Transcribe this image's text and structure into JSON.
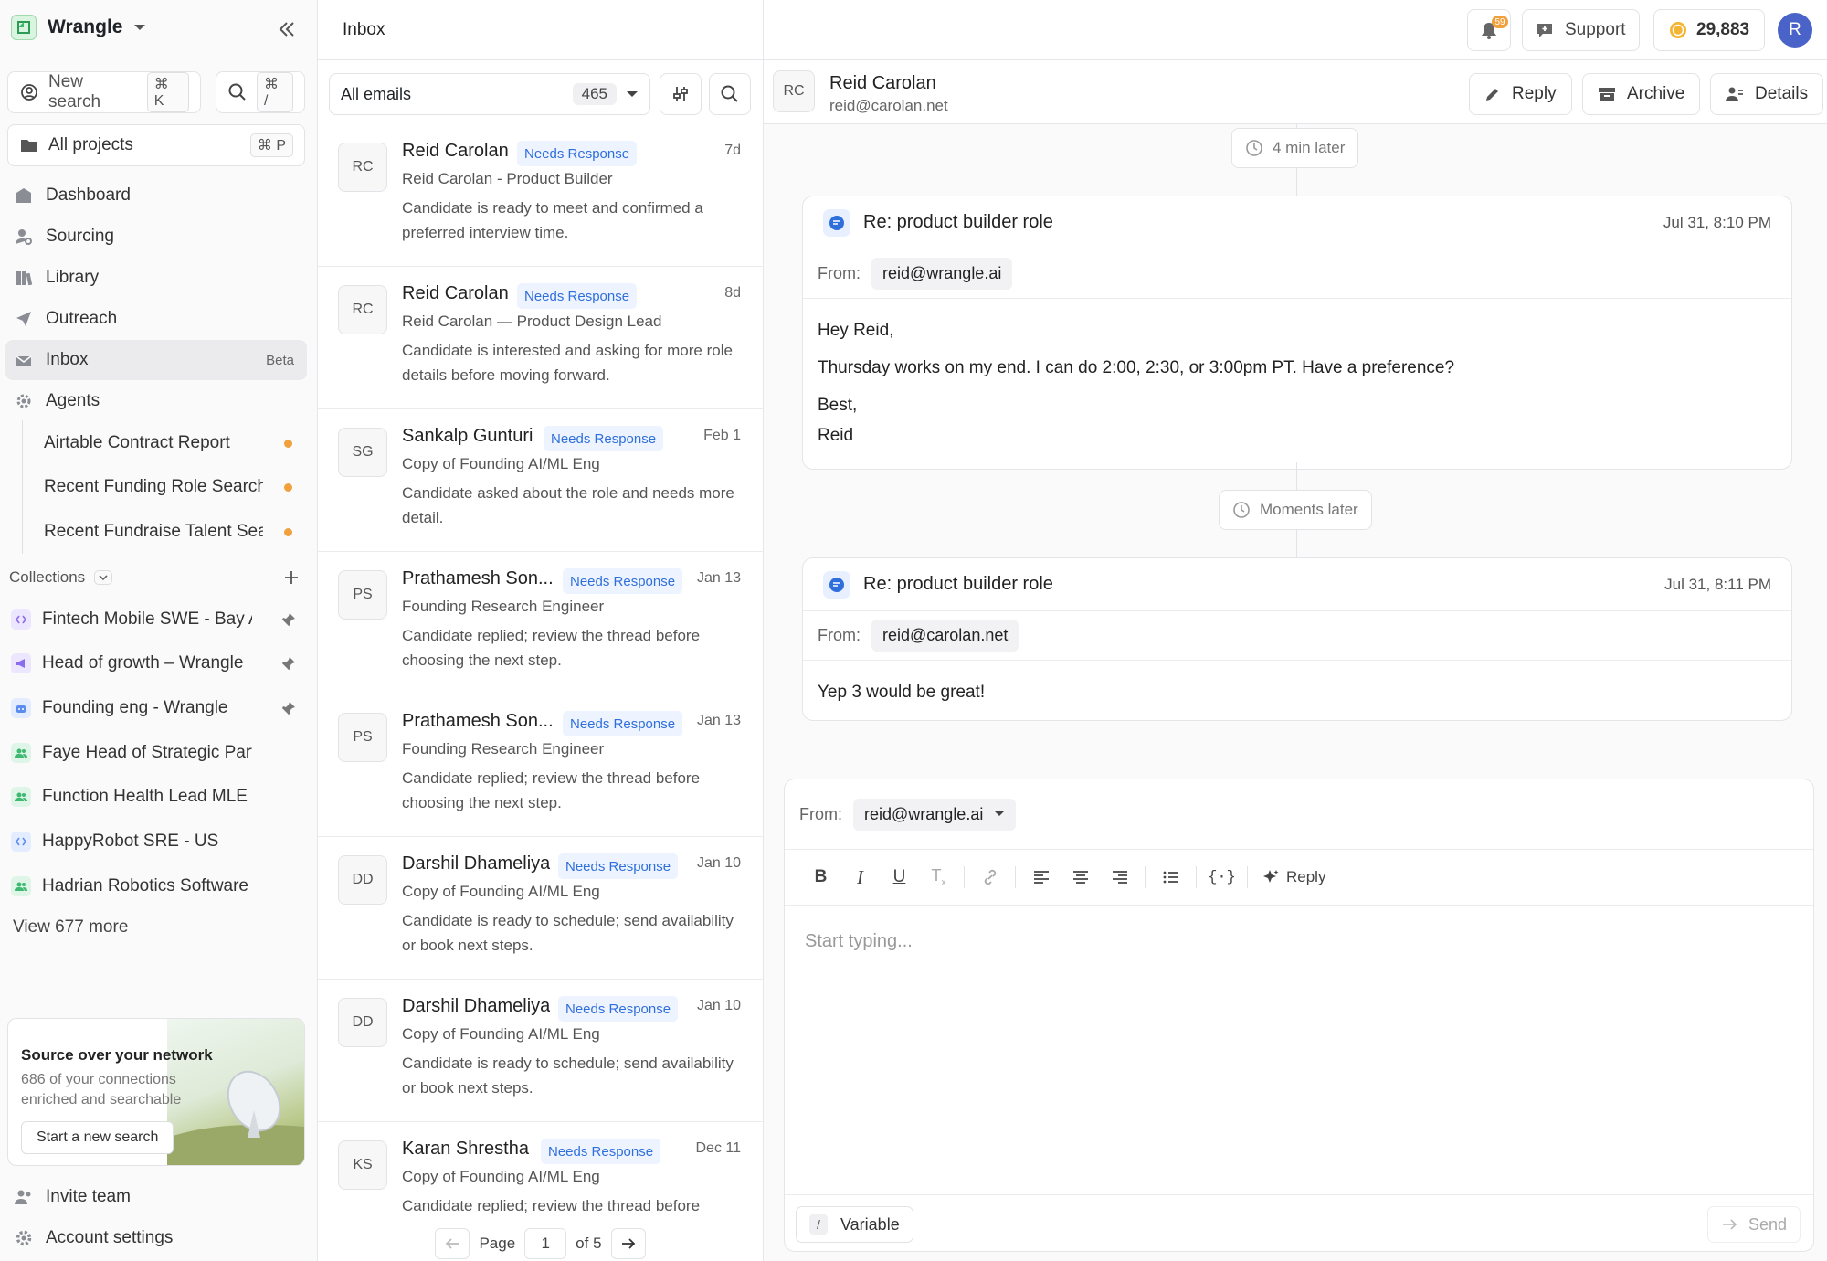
{
  "workspace": {
    "name": "Wrangle"
  },
  "sidebar": {
    "new_search": {
      "label": "New search",
      "shortcut": "⌘ K"
    },
    "quick_search": {
      "shortcut": "⌘ /"
    },
    "projects": {
      "label": "All projects",
      "shortcut": "⌘ P"
    },
    "nav": [
      {
        "label": "Dashboard",
        "icon": "dashboard-icon"
      },
      {
        "label": "Sourcing",
        "icon": "sourcing-icon"
      },
      {
        "label": "Library",
        "icon": "library-icon"
      },
      {
        "label": "Outreach",
        "icon": "outreach-icon"
      },
      {
        "label": "Inbox",
        "icon": "inbox-icon",
        "badge": "Beta",
        "active": true
      },
      {
        "label": "Agents",
        "icon": "agents-icon"
      }
    ],
    "agents": [
      {
        "label": "Airtable Contract Report"
      },
      {
        "label": "Recent Funding Role Search"
      },
      {
        "label": "Recent Fundraise Talent Search"
      }
    ],
    "collections_label": "Collections",
    "collections": [
      {
        "label": "Fintech Mobile SWE - Bay Area",
        "color": "#8b6cf0",
        "pinned": true
      },
      {
        "label": "Head of growth – Wrangle",
        "color": "#8b6cf0",
        "pinned": true
      },
      {
        "label": "Founding eng - Wrangle",
        "color": "#5b8def",
        "pinned": true
      },
      {
        "label": "Faye Head of Strategic Partnerships",
        "color": "#3fb971",
        "pinned": false
      },
      {
        "label": "Function Health Lead MLE SF",
        "color": "#3fb971",
        "pinned": false
      },
      {
        "label": "HappyRobot SRE - US",
        "color": "#5b8def",
        "pinned": false
      },
      {
        "label": "Hadrian Robotics Software Eng",
        "color": "#3fb971",
        "pinned": false
      }
    ],
    "view_more": "View 677 more",
    "promo": {
      "title": "Source over your network",
      "subtitle": "686 of your connections enriched and searchable",
      "button": "Start a new search"
    },
    "invite": "Invite team",
    "settings": "Account settings"
  },
  "list": {
    "title": "Inbox",
    "filter": {
      "label": "All emails",
      "count": "465"
    },
    "status_label": "Needs Response",
    "rows": [
      {
        "initials": "RC",
        "name": "Reid Carolan",
        "date": "7d",
        "subtitle": "Reid Carolan - Product Builder",
        "desc": "Candidate is ready to meet and confirmed a preferred interview time."
      },
      {
        "initials": "RC",
        "name": "Reid Carolan",
        "date": "8d",
        "subtitle": "Reid Carolan — Product Design Lead",
        "desc": "Candidate is interested and asking for more role details before moving forward."
      },
      {
        "initials": "SG",
        "name": "Sankalp Gunturi",
        "date": "Feb 1",
        "subtitle": "Copy of Founding AI/ML Eng",
        "desc": "Candidate asked about the role and needs more detail."
      },
      {
        "initials": "PS",
        "name": "Prathamesh Son...",
        "date": "Jan 13",
        "subtitle": "Founding Research Engineer",
        "desc": "Candidate replied; review the thread before choosing the next step."
      },
      {
        "initials": "PS",
        "name": "Prathamesh Son...",
        "date": "Jan 13",
        "subtitle": "Founding Research Engineer",
        "desc": "Candidate replied; review the thread before choosing the next step."
      },
      {
        "initials": "DD",
        "name": "Darshil Dhameliya",
        "date": "Jan 10",
        "subtitle": "Copy of Founding AI/ML Eng",
        "desc": "Candidate is ready to schedule; send availability or book next steps."
      },
      {
        "initials": "DD",
        "name": "Darshil Dhameliya",
        "date": "Jan 10",
        "subtitle": "Copy of Founding AI/ML Eng",
        "desc": "Candidate is ready to schedule; send availability or book next steps."
      },
      {
        "initials": "KS",
        "name": "Karan Shrestha",
        "date": "Dec 11",
        "subtitle": "Copy of Founding AI/ML Eng",
        "desc": "Candidate replied; review the thread before"
      }
    ],
    "pager": {
      "label": "Page",
      "current": "1",
      "total": "of 5"
    }
  },
  "header": {
    "notifications": "59",
    "support": "Support",
    "credits": "29,883",
    "user_initial": "R"
  },
  "thread": {
    "contact": {
      "initials": "RC",
      "name": "Reid Carolan",
      "email": "reid@carolan.net"
    },
    "actions": {
      "reply": "Reply",
      "archive": "Archive",
      "details": "Details"
    },
    "gap1": "4 min later",
    "gap2": "Moments later",
    "from_label": "From:",
    "messages": [
      {
        "subject": "Re: product builder role",
        "date": "Jul 31, 8:10 PM",
        "from": "reid@wrangle.ai",
        "lines": [
          "Hey Reid,",
          "Thursday works on my end. I can do 2:00, 2:30, or 3:00pm PT. Have a preference?",
          "Best,",
          "Reid"
        ]
      },
      {
        "subject": "Re: product builder role",
        "date": "Jul 31, 8:11 PM",
        "from": "reid@carolan.net",
        "lines": [
          "Yep 3 would be great!"
        ]
      }
    ]
  },
  "composer": {
    "from_label": "From:",
    "from": "reid@wrangle.ai",
    "ai_reply": "Reply",
    "placeholder": "Start typing...",
    "variable": "Variable",
    "variable_key": "/",
    "send": "Send"
  },
  "colors": {
    "accent": "#2f6fdb",
    "status_dot": "#f0a03c",
    "brand": "#3fb971"
  }
}
